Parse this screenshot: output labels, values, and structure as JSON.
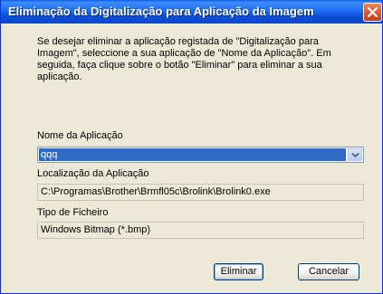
{
  "window": {
    "title": "Eliminação da Digitalização para Aplicação da Imagem",
    "close_icon": "close-icon"
  },
  "instructions": "Se desejar eliminar a aplicação registada de \"Digitalização para Imagem\", seleccione a sua aplicação de \"Nome da Aplicação\". Em seguida, faça clique sobre o botão \"Eliminar\" para eliminar a sua aplicação.",
  "app_name": {
    "label": "Nome da Aplicação",
    "selected_value": "qqq",
    "dropdown_icon": "chevron-down-icon"
  },
  "app_location": {
    "label": "Localização da Aplicação",
    "value": "C:\\Programas\\Brother\\Brmfl05c\\Brolink\\Brolink0.exe"
  },
  "file_type": {
    "label": "Tipo de Ficheiro",
    "value": "Windows Bitmap (*.bmp)"
  },
  "buttons": {
    "delete_label": "Eliminar",
    "cancel_label": "Cancelar"
  },
  "colors": {
    "titlebar": "#0a47c8",
    "dialog_bg": "#ece9d8",
    "selection": "#316ac5"
  }
}
